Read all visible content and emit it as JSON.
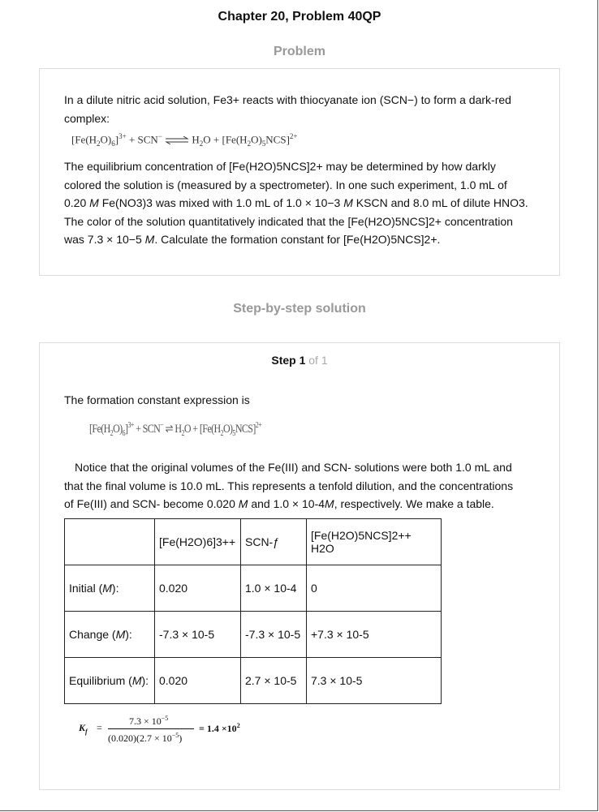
{
  "page_title": "Chapter 20, Problem 40QP",
  "problem_heading": "Problem",
  "problem": {
    "intro": "In a dilute nitric acid solution, Fe3+ reacts with thiocyanate ion (SCN−) to form a dark-red complex:",
    "body_lines": [
      "The equilibrium concentration of [Fe(H2O)5NCS]2+ may be determined by how darkly",
      "colored the solution is (measured by a spectrometer). In one such experiment, 1.0 mL of",
      "0.20 M Fe(NO3)3 was mixed with 1.0 mL of 1.0 × 10−3 M KSCN and 8.0 mL of dilute HNO3.",
      "The color of the solution quantitatively indicated that the [Fe(H2O)5NCS]2+ concentration",
      "was 7.3 × 10−5 M. Calculate the formation constant for [Fe(H2O)5NCS]2+."
    ]
  },
  "solution_heading": "Step-by-step solution",
  "step": {
    "label": "Step 1",
    "of": "of 1",
    "intro": "The formation constant expression is",
    "note_lines": [
      "Notice that the original volumes of the Fe(III) and SCN- solutions were both 1.0 mL and",
      "that the final volume is 10.0 mL. This represents a tenfold dilution, and the concentrations",
      "of Fe(III) and SCN- become 0.020 M and 1.0 × 10-4M, respectively. We make a table."
    ]
  },
  "table": {
    "headers": [
      "",
      "[Fe(H2O)6]3++",
      "SCN-ƒ",
      "[Fe(H2O)5NCS]2++ H2O"
    ],
    "rows": [
      [
        "Initial (M):",
        "0.020",
        "1.0 × 10-4",
        "0"
      ],
      [
        "Change (M):",
        "-7.3 × 10-5",
        "-7.3 × 10-5",
        "+7.3 × 10-5"
      ],
      [
        "Equilibrium (M):",
        "0.020",
        "2.7 × 10-5",
        "7.3 × 10-5"
      ]
    ]
  },
  "kf": {
    "symbol": "K",
    "sub": "f",
    "numerator": "7.3 × 10",
    "numerator_exp": "−5",
    "denominator": "(0.020)(2.7 × 10",
    "denominator_exp": "−5",
    "result": "= 1.4 ×10",
    "result_exp": "2"
  }
}
